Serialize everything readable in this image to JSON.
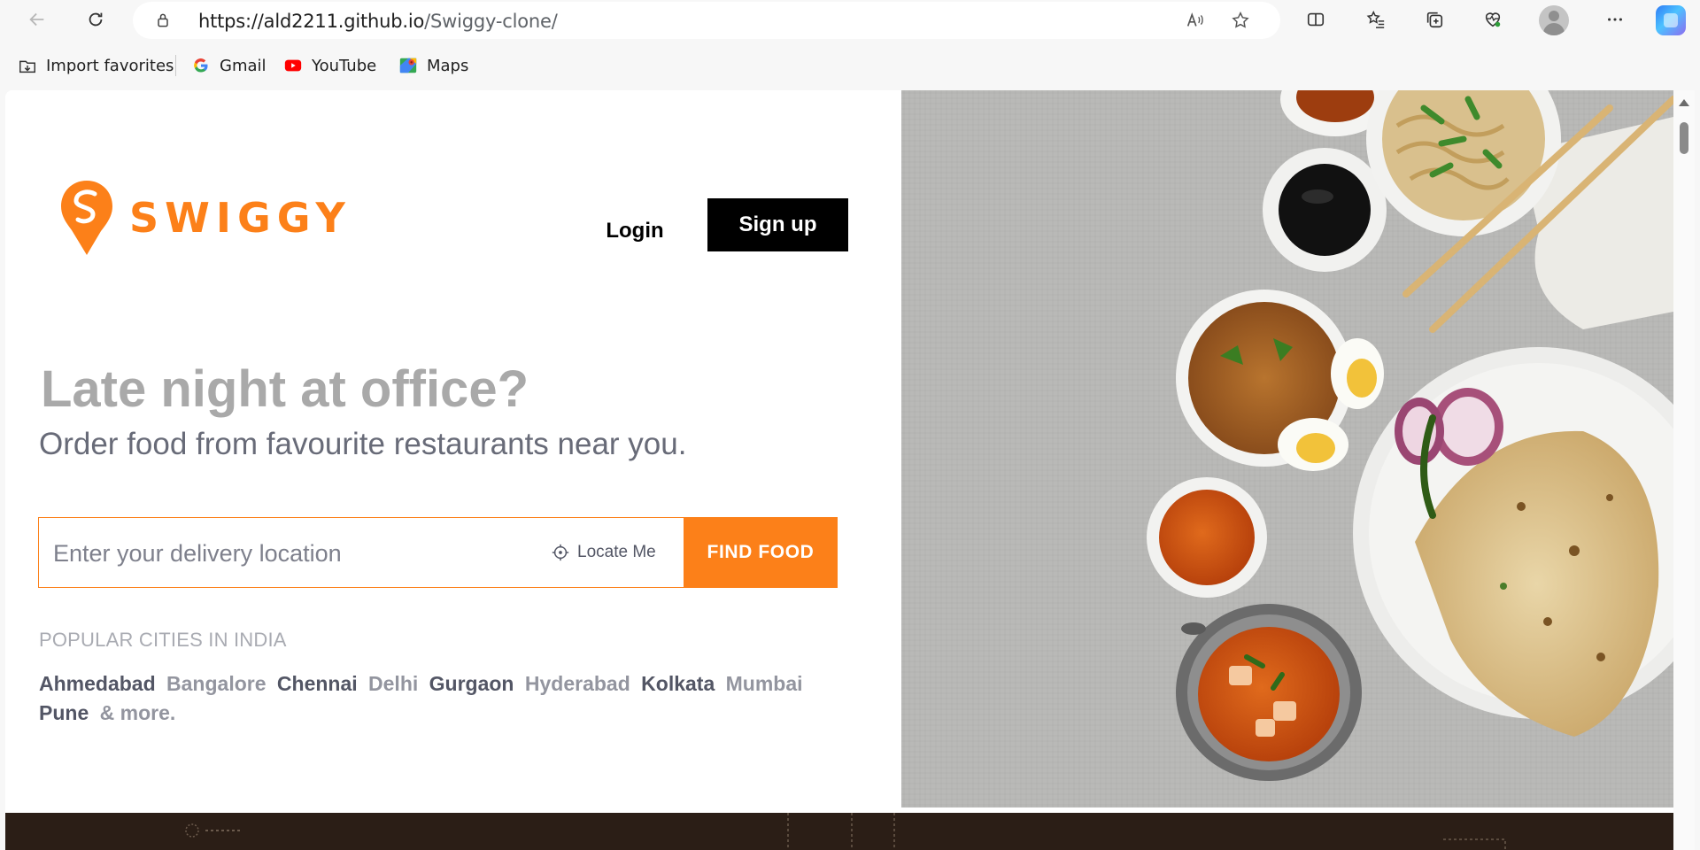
{
  "browser": {
    "url_host": "https://ald2211.github.io",
    "url_path": "/Swiggy-clone/",
    "favorites": [
      {
        "label": "Import favorites",
        "icon": "import-favorites-icon"
      },
      {
        "label": "Gmail",
        "icon": "google-icon"
      },
      {
        "label": "YouTube",
        "icon": "youtube-icon"
      },
      {
        "label": "Maps",
        "icon": "maps-icon"
      }
    ]
  },
  "header": {
    "logo_text": "SWIGGY",
    "login_label": "Login",
    "signup_label": "Sign up"
  },
  "hero": {
    "headline": "Late night at office?",
    "subline": "Order food from favourite restaurants near you."
  },
  "search": {
    "placeholder": "Enter your delivery location",
    "locate_label": "Locate Me",
    "find_label": "FIND FOOD"
  },
  "popular": {
    "title": "POPULAR CITIES IN INDIA",
    "cities": [
      {
        "name": "Ahmedabad",
        "tone": "dark"
      },
      {
        "name": "Bangalore",
        "tone": "light"
      },
      {
        "name": "Chennai",
        "tone": "dark"
      },
      {
        "name": "Delhi",
        "tone": "light"
      },
      {
        "name": "Gurgaon",
        "tone": "dark"
      },
      {
        "name": "Hyderabad",
        "tone": "light"
      },
      {
        "name": "Kolkata",
        "tone": "dark"
      },
      {
        "name": "Mumbai",
        "tone": "light"
      },
      {
        "name": "Pune",
        "tone": "dark"
      },
      {
        "name": "& more.",
        "tone": "light"
      }
    ]
  },
  "colors": {
    "brand_orange": "#fc8019",
    "signup_bg": "#000000",
    "footer_band": "#2b1e16"
  }
}
